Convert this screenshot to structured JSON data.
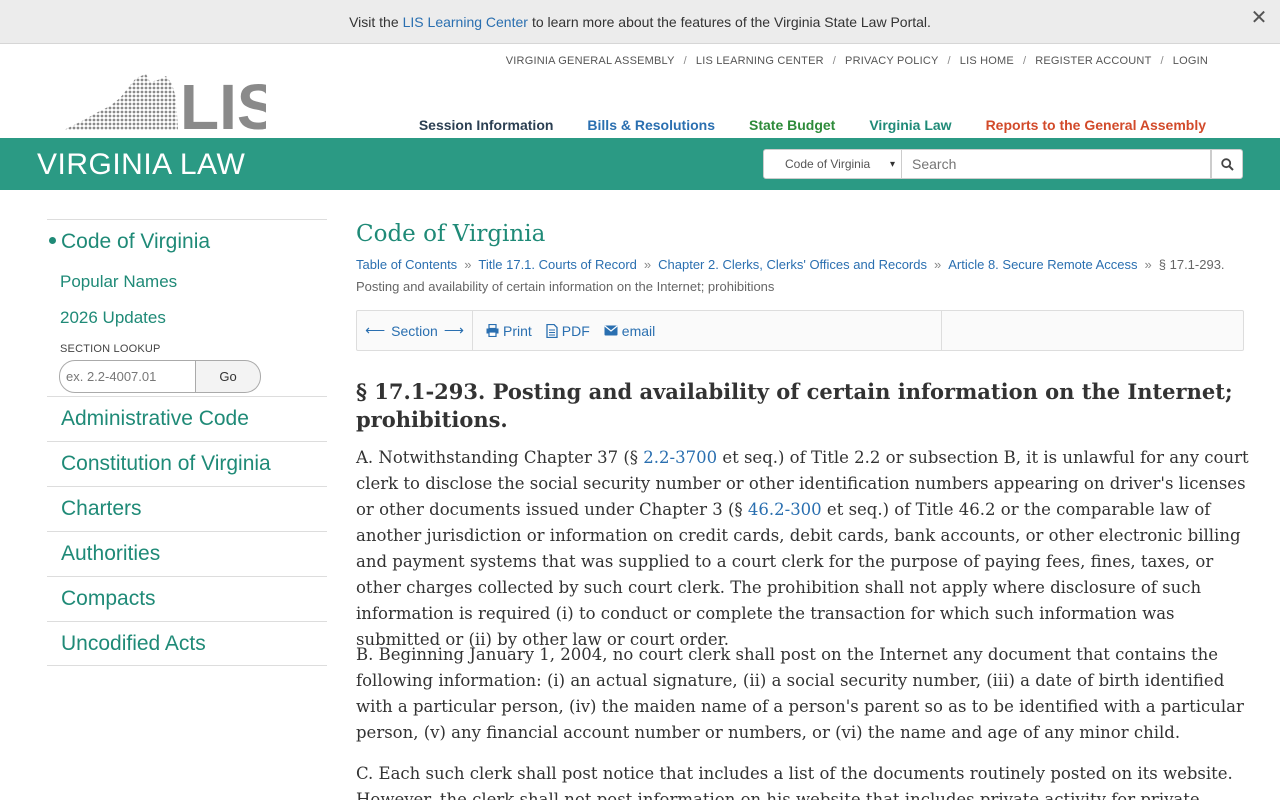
{
  "notice": {
    "prefix": "Visit the",
    "link": "LIS Learning Center",
    "suffix": "to learn more about the features of the Virginia State Law Portal.",
    "close": "✕"
  },
  "logo": {
    "text": "LIS"
  },
  "utility_nav": [
    "VIRGINIA GENERAL ASSEMBLY",
    "LIS LEARNING CENTER",
    "PRIVACY POLICY",
    "LIS HOME",
    "REGISTER ACCOUNT",
    "LOGIN"
  ],
  "main_nav": {
    "session": "Session Information",
    "bills": "Bills & Resolutions",
    "budget": "State Budget",
    "law": "Virginia Law",
    "reports": "Reports to the General Assembly"
  },
  "band": {
    "title": "VIRGINIA LAW",
    "select_value": "Code of Virginia",
    "search_placeholder": "Search"
  },
  "sidebar": {
    "active": "Code of Virginia",
    "sub": [
      "Popular Names",
      "2026 Updates"
    ],
    "lookup_label": "SECTION LOOKUP",
    "lookup_placeholder": "ex.  2.2-4007.01",
    "go": "Go",
    "items": [
      "Administrative Code",
      "Constitution of Virginia",
      "Charters",
      "Authorities",
      "Compacts",
      "Uncodified Acts"
    ]
  },
  "main": {
    "title": "Code of Virginia",
    "breadcrumb": [
      "Table of Contents",
      "Title 17.1. Courts of Record",
      "Chapter 2. Clerks, Clerks' Offices and Records",
      "Article 8. Secure Remote Access"
    ],
    "breadcrumb_current": "§ 17.1-293. Posting and availability of certain information on the Internet; prohibitions",
    "toolbar": {
      "section": "Section",
      "print": "Print",
      "pdf": "PDF",
      "email": "email"
    },
    "heading": "§ 17.1-293. Posting and availability of certain information on the Internet; prohibitions.",
    "para_a": {
      "t1": "A. Notwithstanding Chapter 37 (§ ",
      "link1": "2.2-3700",
      "t2": " et seq.) of Title 2.2 or subsection B, it is unlawful for any court clerk to disclose the social security number or other identification numbers appearing on driver's licenses or other documents issued under Chapter 3 (§ ",
      "link2": "46.2-300",
      "t3": " et seq.) of Title 46.2 or the comparable law of another jurisdiction or information on credit cards, debit cards, bank accounts, or other electronic billing and payment systems that was supplied to a court clerk for the purpose of paying fees, fines, taxes, or other charges collected by such court clerk. The prohibition shall not apply where disclosure of such information is required (i) to conduct or complete the transaction for which such information was submitted or (ii) by other law or court order."
    },
    "para_b": "B. Beginning January 1, 2004, no court clerk shall post on the Internet any document that contains the following information: (i) an actual signature, (ii) a social security number, (iii) a date of birth identified with a particular person, (iv) the maiden name of a person's parent so as to be identified with a particular person, (v) any financial account number or numbers, or (vi) the name and age of any minor child.",
    "para_c": "C. Each such clerk shall post notice that includes a list of the documents routinely posted on its website. However, the clerk shall not post information on his website that includes private activity for private financial"
  },
  "colors": {
    "brand_green": "#2b9a84",
    "link_blue": "#2a6fb0",
    "reports_red": "#d24a2a"
  }
}
